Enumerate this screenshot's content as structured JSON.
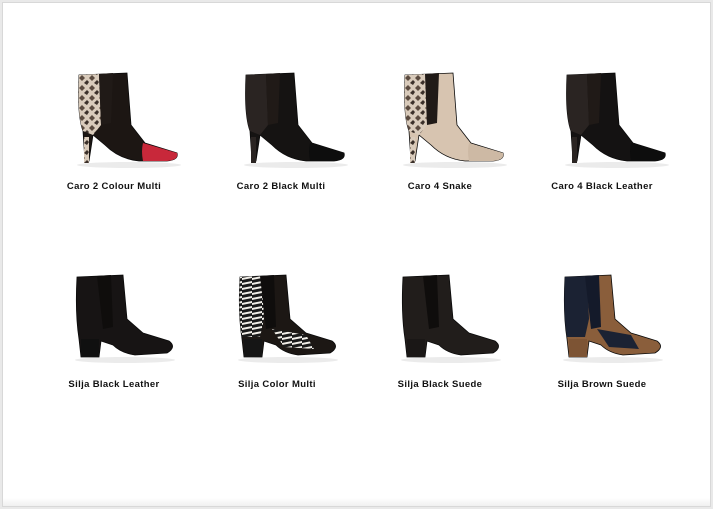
{
  "products": [
    {
      "name": "Caro 2 Colour Multi",
      "style": "caro",
      "base": "#1c1613",
      "accent": "snake",
      "toe": "#c8283a"
    },
    {
      "name": "Caro 2 Black Multi",
      "style": "caro",
      "base": "#151312",
      "accent": "black",
      "toe": "#0d0d0d"
    },
    {
      "name": "Caro 4 Snake",
      "style": "caro",
      "base": "#d7c4b0",
      "accent": "snake",
      "toe": "#cdb9a4"
    },
    {
      "name": "Caro 4 Black Leather",
      "style": "caro",
      "base": "#141212",
      "accent": "black",
      "toe": "#0d0d0d"
    },
    {
      "name": "Silja Black Leather",
      "style": "silja",
      "base": "#171414",
      "accent": "black",
      "toe": "#101010"
    },
    {
      "name": "Silja Color Multi",
      "style": "silja",
      "base": "#1c1714",
      "accent": "zebra",
      "toe": "#151515"
    },
    {
      "name": "Silja Black Suede",
      "style": "silja",
      "base": "#211d1b",
      "accent": "black",
      "toe": "#1a1716"
    },
    {
      "name": "Silja Brown Suede",
      "style": "silja",
      "base": "#8a5e3b",
      "accent": "navy",
      "toe": "#7d5434"
    }
  ],
  "colors": {
    "page": "#ffffff",
    "text": "#111111"
  }
}
